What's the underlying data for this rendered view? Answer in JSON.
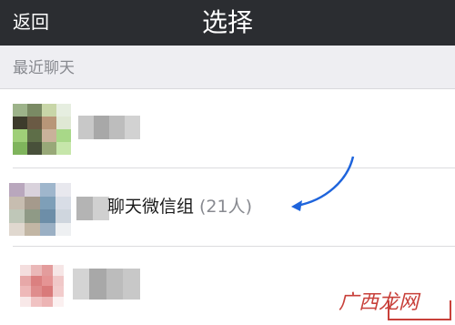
{
  "header": {
    "back_label": "返回",
    "title": "选择"
  },
  "section": {
    "label": "最近聊天"
  },
  "chats": [
    {
      "name": "",
      "blurred": true
    },
    {
      "name": "聊天微信组",
      "count": "(21人)",
      "blurred_prefix": true
    },
    {
      "name": "",
      "blurred": true
    }
  ],
  "watermark": {
    "text": "广西龙网"
  },
  "colors": {
    "header_bg": "#2b2d31",
    "section_bg": "#eeeef2",
    "arrow": "#1e64dc",
    "watermark": "#c8403a"
  }
}
